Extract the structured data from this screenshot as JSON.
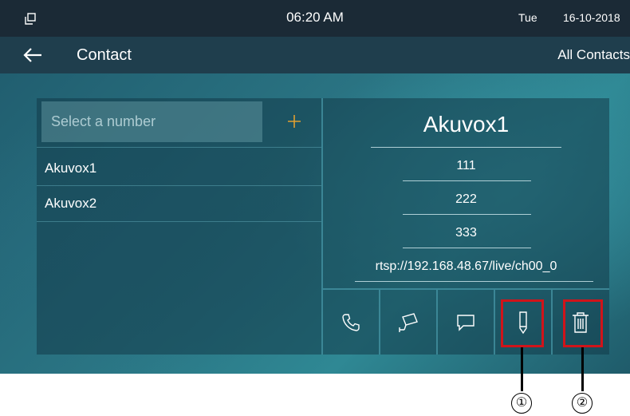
{
  "status_bar": {
    "time": "06:20 AM",
    "day": "Tue",
    "date": "16-10-2018"
  },
  "header": {
    "title": "Contact",
    "filter_label": "All Contacts"
  },
  "search": {
    "placeholder": "Select a number"
  },
  "contacts": [
    {
      "name": "Akuvox1"
    },
    {
      "name": "Akuvox2"
    }
  ],
  "detail": {
    "name": "Akuvox1",
    "numbers": [
      "111",
      "222",
      "333"
    ],
    "rtsp": "rtsp://192.168.48.67/live/ch00_0"
  },
  "actions": [
    {
      "icon": "phone-icon"
    },
    {
      "icon": "camera-icon"
    },
    {
      "icon": "message-icon"
    },
    {
      "icon": "edit-pencil-icon"
    },
    {
      "icon": "trash-icon"
    }
  ],
  "callouts": [
    "①",
    "②"
  ],
  "colors": {
    "highlight": "#d0141a",
    "accent_plus": "#e0a030",
    "status_bar": "#1b2a36",
    "title_bar": "#1f3e4d"
  }
}
